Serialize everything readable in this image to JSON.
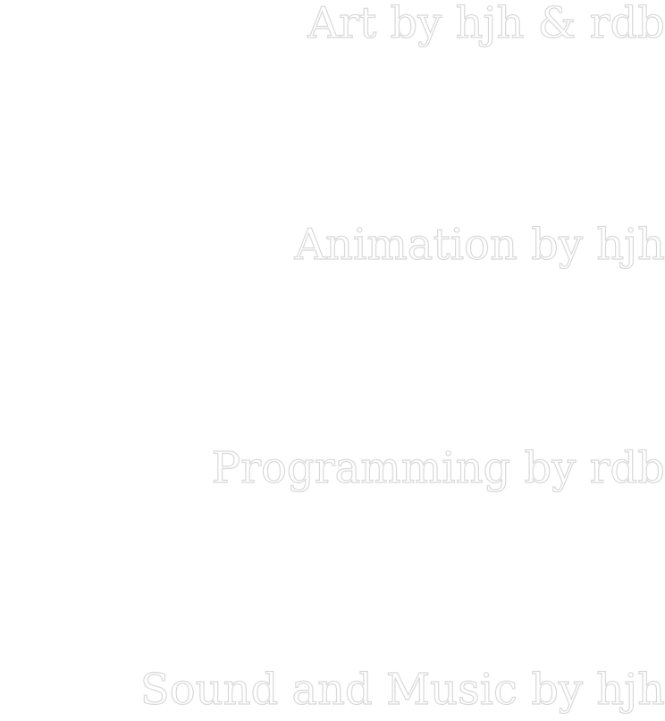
{
  "credits": {
    "art": "Art by hjh & rdb",
    "animation": "Animation by hjh",
    "programming": "Programming by rdb",
    "sound_music": "Sound and Music by hjh"
  },
  "colors": {
    "background": "#ffffff",
    "text_fill": "#ffffff",
    "text_outline": "#d9d9d9"
  }
}
